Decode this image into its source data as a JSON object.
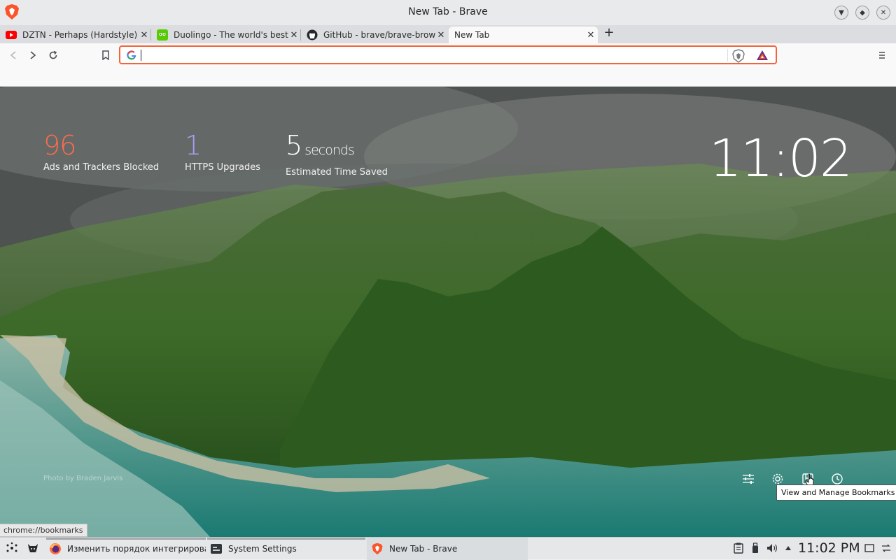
{
  "window": {
    "title": "New Tab - Brave"
  },
  "tabs": [
    {
      "label": "DZTN - Perhaps (Hardstyle) | H",
      "icon": "youtube-icon"
    },
    {
      "label": "Duolingo - The world's best wa",
      "icon": "duolingo-icon"
    },
    {
      "label": "GitHub - brave/brave-browser",
      "icon": "github-icon"
    },
    {
      "label": "New Tab",
      "icon": "",
      "active": true
    }
  ],
  "toolbar": {
    "address_value": "",
    "address_placeholder": ""
  },
  "newtab": {
    "stats": [
      {
        "value": "96",
        "unit": "",
        "label": "Ads and Trackers Blocked",
        "color": "#ff6a4d"
      },
      {
        "value": "1",
        "unit": "",
        "label": "HTTPS Upgrades",
        "color": "#a99df3"
      },
      {
        "value": "5",
        "unit": "seconds",
        "label": "Estimated Time Saved",
        "color": "#ffffff"
      }
    ],
    "clock": "11:02",
    "credit": "Photo by Braden Jarvis",
    "tooltip": "View and Manage Bookmarks",
    "status_url": "chrome://bookmarks"
  },
  "taskbar": {
    "tasks": [
      {
        "label": "Изменить порядок интегрирова...",
        "icon": "firefox-icon"
      },
      {
        "label": "System Settings",
        "icon": "settings-icon"
      },
      {
        "label": "New Tab - Brave",
        "icon": "brave-icon"
      }
    ],
    "clock": "11:02 PM"
  },
  "colors": {
    "accent": "#3daee9",
    "omnibox_border": "#f4643a",
    "brave_orange": "#fb542b"
  }
}
